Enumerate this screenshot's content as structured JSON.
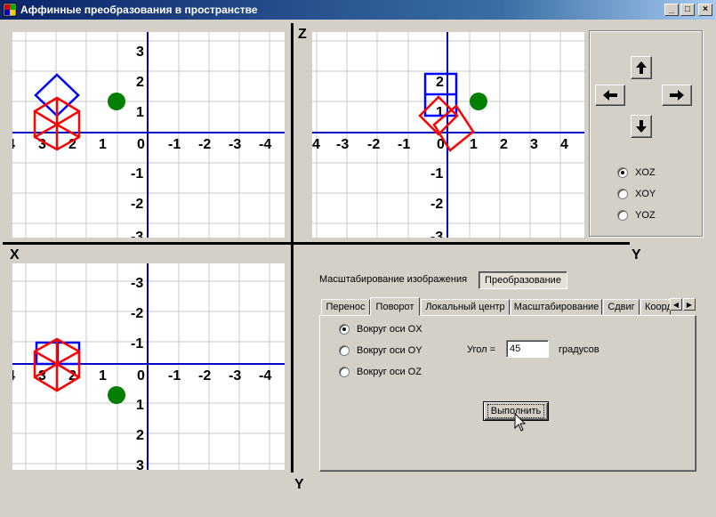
{
  "window": {
    "title": "Аффинные преобразования в пространстве",
    "minimize": "_",
    "maximize": "□",
    "close": "×"
  },
  "axes": {
    "z": "Z",
    "x": "X",
    "y_top": "Y",
    "y_bottom": "Y"
  },
  "plots": {
    "xoz": {
      "x_ticks": [
        "4",
        "3",
        "2",
        "1",
        "0",
        "-1",
        "-2",
        "-3",
        "-4"
      ],
      "y_ticks": [
        "3",
        "2",
        "1",
        "-1",
        "-2",
        "-3"
      ]
    },
    "yoz": {
      "x_ticks": [
        "4",
        "-3",
        "-2",
        "-1",
        "0",
        "1",
        "2",
        "3",
        "4"
      ],
      "y_ticks": [
        "2",
        "1",
        "-1",
        "-2",
        "-3"
      ]
    },
    "xoy": {
      "x_ticks": [
        "4",
        "3",
        "2",
        "1",
        "0",
        "-1",
        "-2",
        "-3",
        "-4"
      ],
      "y_ticks": [
        "-3",
        "-2",
        "-1",
        "1",
        "2",
        "3"
      ]
    },
    "colors": {
      "grid": "#c8c8c8",
      "axis": "#0000c8",
      "original": "#0000ff",
      "transformed": "#ff0000",
      "center": "#008000"
    }
  },
  "navigation": {
    "up_icon": "arrow-up-icon",
    "left_icon": "arrow-left-icon",
    "right_icon": "arrow-right-icon",
    "down_icon": "arrow-down-icon",
    "planes": [
      {
        "label": "XOZ",
        "selected": true
      },
      {
        "label": "XOY",
        "selected": false
      },
      {
        "label": "YOZ",
        "selected": false
      }
    ]
  },
  "modes": {
    "scale_label": "Масштабирование изображения",
    "transform_button": "Преобразование"
  },
  "tabs": [
    {
      "label": "Перенос",
      "active": false
    },
    {
      "label": "Поворот",
      "active": true
    },
    {
      "label": "Локальный центр",
      "active": false
    },
    {
      "label": "Масштабирование",
      "active": false
    },
    {
      "label": "Сдвиг",
      "active": false
    },
    {
      "label": "Коорд",
      "active": false
    }
  ],
  "rotation": {
    "options": [
      {
        "label": "Вокруг оси OX",
        "selected": true
      },
      {
        "label": "Вокруг оси OY",
        "selected": false
      },
      {
        "label": "Вокруг оси OZ",
        "selected": false
      }
    ],
    "angle_label": "Угол =",
    "angle_value": "45",
    "degrees_label": "градусов",
    "run_button": "Выполнить"
  }
}
